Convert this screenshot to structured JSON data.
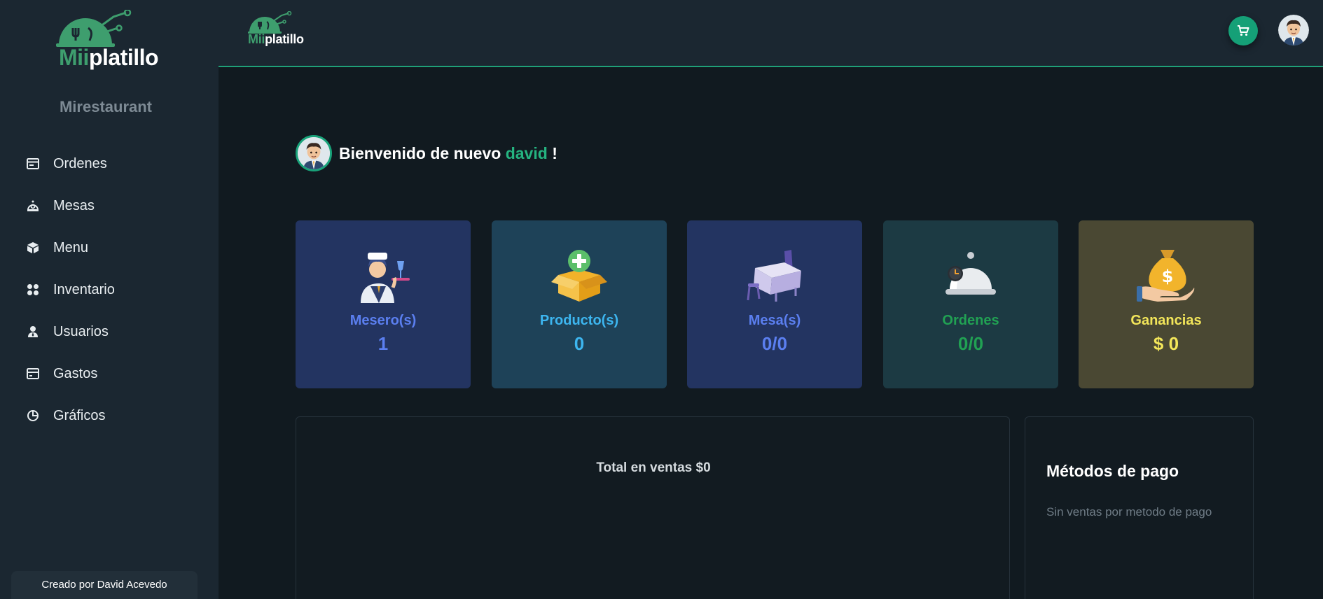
{
  "brand": {
    "logo_part1": "Mii",
    "logo_part2": "platillo"
  },
  "sidebar": {
    "restaurant_name": "Mirestaurant",
    "items": [
      {
        "label": "Ordenes",
        "icon": "orders-icon"
      },
      {
        "label": "Mesas",
        "icon": "tables-icon"
      },
      {
        "label": "Menu",
        "icon": "menu-box-icon"
      },
      {
        "label": "Inventario",
        "icon": "inventory-icon"
      },
      {
        "label": "Usuarios",
        "icon": "users-icon"
      },
      {
        "label": "Gastos",
        "icon": "expenses-icon"
      },
      {
        "label": "Gráficos",
        "icon": "chart-icon"
      }
    ],
    "footer": "Creado por David Acevedo"
  },
  "header": {
    "cart_icon": "cart-icon"
  },
  "welcome": {
    "prefix": "Bienvenido de nuevo",
    "user": "david",
    "suffix": "!"
  },
  "cards": [
    {
      "label": "Mesero(s)",
      "value": "1",
      "color": "#5b7ff0",
      "bg": "#233461"
    },
    {
      "label": "Producto(s)",
      "value": "0",
      "color": "#3db6f0",
      "bg": "#1e4258"
    },
    {
      "label": "Mesa(s)",
      "value": "0/0",
      "color": "#5b7ff0",
      "bg": "#233461"
    },
    {
      "label": "Ordenes",
      "value": "0/0",
      "color": "#21a153",
      "bg": "#1c3a43"
    },
    {
      "label": "Ganancias",
      "value": "$ 0",
      "color": "#f3e65a",
      "bg": "#4a4833"
    }
  ],
  "sales": {
    "title": "Total en ventas $0"
  },
  "payments": {
    "title": "Métodos de pago",
    "empty": "Sin ventas por metodo de pago"
  }
}
